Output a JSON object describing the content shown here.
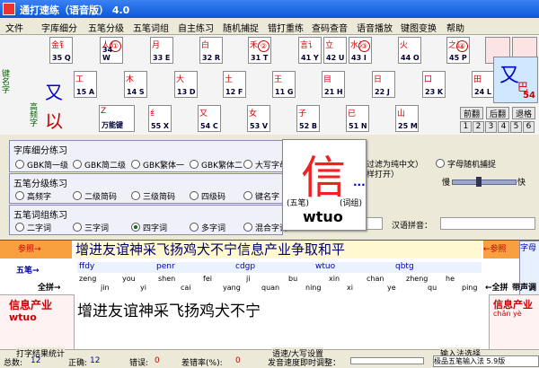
{
  "window": {
    "title": "通打速练（语音版） 4.0"
  },
  "menu": [
    "文件",
    "字库细分",
    "五笔分级",
    "五笔词组",
    "自主练习",
    "随机捕捉",
    "错打重练",
    "查码查音",
    "语音播放",
    "键图变换",
    "帮助"
  ],
  "keyboard": {
    "row1": [
      {
        "root": "金钅",
        "label": "35 Q"
      },
      {
        "root": "人亻",
        "label": "34 W",
        "mark": "①"
      },
      {
        "root": "月",
        "label": "33 E"
      },
      {
        "root": "白",
        "label": "32 R"
      },
      {
        "root": "禾",
        "label": "31 T",
        "mark": "②"
      },
      {
        "root": "言讠",
        "label": "41 Y"
      },
      {
        "root": "立",
        "label": "42 U"
      },
      {
        "root": "水氵",
        "label": "43 I",
        "mark": "③"
      },
      {
        "root": "火",
        "label": "44 O"
      },
      {
        "root": "之辶",
        "label": "45 P",
        "mark": "④"
      }
    ],
    "row2": [
      {
        "root": "工",
        "label": "15 A"
      },
      {
        "root": "木",
        "label": "14 S"
      },
      {
        "root": "大",
        "label": "13 D"
      },
      {
        "root": "土",
        "label": "12 F"
      },
      {
        "root": "王",
        "label": "11 G"
      },
      {
        "root": "目",
        "label": "21 H"
      },
      {
        "root": "日",
        "label": "22 J"
      },
      {
        "root": "口",
        "label": "23 K"
      },
      {
        "root": "田",
        "label": "24 L"
      }
    ],
    "row3": [
      {
        "root": "纟",
        "label": "55 X"
      },
      {
        "root": "又",
        "label": "54 C"
      },
      {
        "root": "女",
        "label": "53 V"
      },
      {
        "root": "子",
        "label": "52 B"
      },
      {
        "root": "已",
        "label": "51 N"
      },
      {
        "root": "山",
        "label": "25 M"
      }
    ],
    "side_label_1": "键名字",
    "side_label_2": "高频字",
    "side_char_1": "又",
    "side_char_2": "以",
    "z_key": "Z",
    "z_label": "万能键",
    "hl_key_char": "又",
    "hl_key_sub": "巴",
    "hl_key_num": "54",
    "nav": {
      "prev": "前翻",
      "next": "后翻",
      "back": "退格"
    },
    "numpad": [
      "1",
      "2",
      "3",
      "4",
      "5",
      "6"
    ]
  },
  "section1": {
    "title": "字库细分练习",
    "options": [
      "GBK简一级",
      "GBK简二级",
      "GBK繁体一",
      "GBK繁体二",
      "大写字母"
    ],
    "right_options": [
      "过滤为纯中文）",
      "字母随机捕捉"
    ],
    "right_note": "样打开）"
  },
  "section2": {
    "title": "五笔分级练习",
    "options": [
      "高频字",
      "二级简码",
      "三级简码",
      "四级码",
      "键名字"
    ],
    "speed_slow": "慢",
    "speed_fast": "快",
    "slider_level": 0.4
  },
  "section3": {
    "title": "五笔词组练习",
    "options": [
      "二字词",
      "三字词",
      "四字词",
      "多字词",
      "混合字词"
    ],
    "selected_index": 2,
    "pinyin_label": "汉语拼音："
  },
  "popup": {
    "char": "信",
    "tag_left": "(五笔)",
    "tag_right": "(词组)",
    "code": "wtuo",
    "dots": "..."
  },
  "practice": {
    "ref_label": "参照→",
    "ref_label_right": "←参照",
    "ref_text": "增进友谊神采飞扬鸡犬不宁信息产业争取和平",
    "wubi_label": "五笔→",
    "fullpin_label": "全拼→",
    "fullpin_label_right": "←全拼",
    "extra_label": "带声调",
    "codes": [
      "ffdy",
      "penr",
      "cdgp",
      "wtuo",
      "qbtg"
    ],
    "pinyin": [
      "zeng",
      "jin",
      "you",
      "yi",
      "shen",
      "cai",
      "fei",
      "yang",
      "ji",
      "quan",
      "bu",
      "ning",
      "xin",
      "xi",
      "chan",
      "ye",
      "zheng",
      "qu",
      "he",
      "ping"
    ],
    "current_word": "信息产业",
    "current_code": "wtuo",
    "typed_text": "增进友谊神采飞扬鸡犬不宁",
    "right_word": "信息产业",
    "right_pinyin": "chǎn yè",
    "right_tag": "字母"
  },
  "stats": {
    "title": "打字结果统计",
    "total_label": "总数:",
    "total": "12",
    "correct_label": "正确:",
    "correct": "12",
    "wrong_label": "错误:",
    "wrong": "0",
    "errrate_label": "差错率(%):",
    "errrate": "0"
  },
  "speed": {
    "title": "语速/大写设置",
    "label": "发音速度即时调整："
  },
  "ime": {
    "title": "输入法选择",
    "value": "极品五笔输入法 5.9版"
  }
}
